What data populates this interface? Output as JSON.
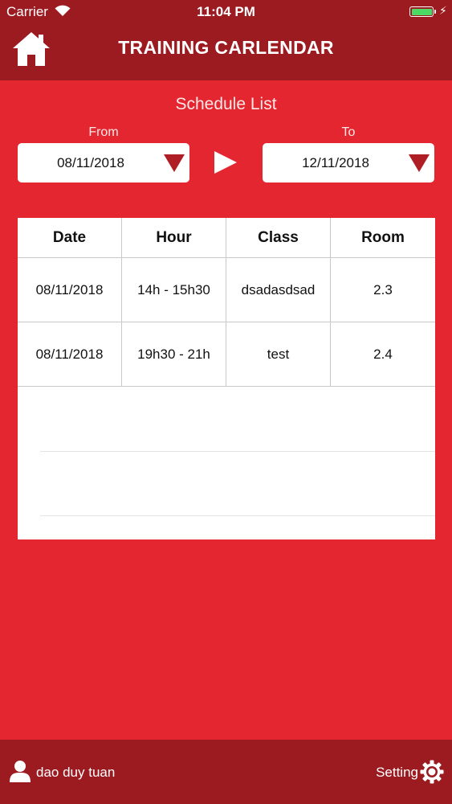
{
  "status_bar": {
    "carrier": "Carrier",
    "time": "11:04 PM"
  },
  "header": {
    "title": "TRAINING CARLENDAR",
    "home_icon": "home-icon"
  },
  "schedule": {
    "title": "Schedule List",
    "from_label": "From",
    "to_label": "To",
    "from_value": "08/11/2018",
    "to_value": "12/11/2018"
  },
  "table": {
    "headers": [
      "Date",
      "Hour",
      "Class",
      "Room"
    ],
    "rows": [
      [
        "08/11/2018",
        "14h - 15h30",
        "dsadasdsad",
        "2.3"
      ],
      [
        "08/11/2018",
        "19h30 - 21h",
        "test",
        "2.4"
      ]
    ]
  },
  "footer": {
    "user_name": "dao duy tuan",
    "setting_label": "Setting"
  },
  "colors": {
    "background": "#e3262f",
    "bar": "#9c1b21",
    "caret": "#b01e25",
    "battery": "#4cd964"
  }
}
